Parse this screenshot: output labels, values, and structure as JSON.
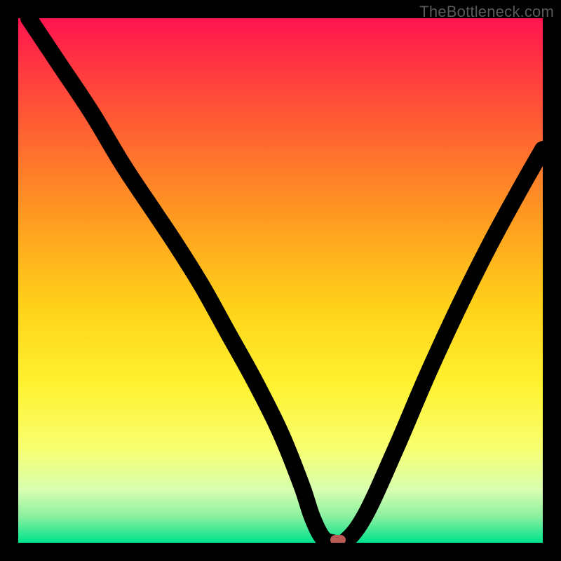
{
  "watermark": "TheBottleneck.com",
  "colors": {
    "frame": "#000000",
    "watermark_text": "#595959",
    "curve": "#000000",
    "marker": "#bb5a55",
    "gradient_stops": [
      {
        "offset": 0.0,
        "color": "#ff1450"
      },
      {
        "offset": 0.1,
        "color": "#ff3a3f"
      },
      {
        "offset": 0.25,
        "color": "#ff6e2e"
      },
      {
        "offset": 0.4,
        "color": "#ffa11f"
      },
      {
        "offset": 0.55,
        "color": "#ffd21a"
      },
      {
        "offset": 0.7,
        "color": "#fff230"
      },
      {
        "offset": 0.82,
        "color": "#f8ff70"
      },
      {
        "offset": 0.9,
        "color": "#d7ffb0"
      },
      {
        "offset": 0.95,
        "color": "#8af0a0"
      },
      {
        "offset": 1.0,
        "color": "#00e28c"
      }
    ]
  },
  "chart_data": {
    "type": "line",
    "title": "",
    "xlabel": "",
    "ylabel": "",
    "xlim": [
      0,
      100
    ],
    "ylim": [
      0,
      100
    ],
    "series": [
      {
        "name": "bottleneck-curve",
        "x": [
          2,
          8,
          14,
          20,
          26,
          30,
          35,
          40,
          45,
          50,
          54,
          56,
          58,
          60,
          62,
          66,
          72,
          78,
          84,
          90,
          96,
          100
        ],
        "y": [
          100,
          91,
          82,
          72,
          63,
          57,
          49,
          40,
          31,
          21,
          11,
          5,
          1,
          0,
          0,
          5,
          18,
          32,
          45,
          57,
          68,
          75
        ]
      }
    ],
    "marker": {
      "x": 61,
      "y": 0.5,
      "color": "#bb5a55"
    },
    "background": "vertical-gradient-red-to-green",
    "grid": false,
    "legend": false
  }
}
